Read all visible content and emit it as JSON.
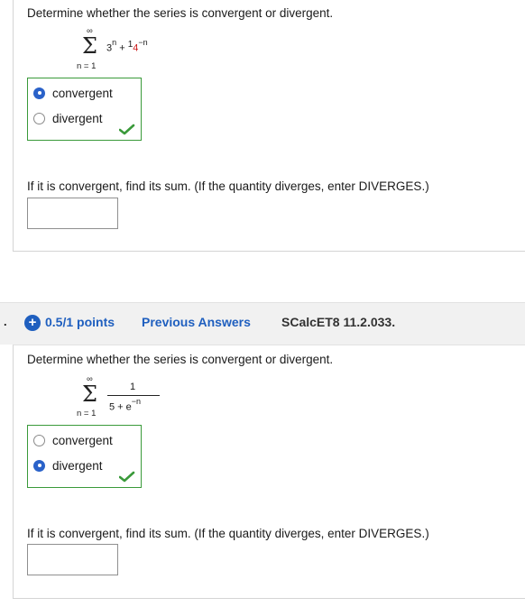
{
  "question1": {
    "prompt": "Determine whether the series is convergent or divergent.",
    "series": {
      "upper": "∞",
      "lower": "n = 1",
      "term_a": "3",
      "term_a_exp": "n",
      "plus": "+",
      "term_b": "1",
      "term_b_red": "4",
      "term_b_exp": "−n"
    },
    "choices": [
      {
        "label": "convergent",
        "selected": true
      },
      {
        "label": "divergent",
        "selected": false
      }
    ],
    "sum_prompt": "If it is convergent, find its sum. (If the quantity diverges, enter DIVERGES.)",
    "sum_value": ""
  },
  "question2": {
    "number": ".",
    "points": "0.5/1 points",
    "previous_answers": "Previous Answers",
    "code": "SCalcET8 11.2.033.",
    "prompt": "Determine whether the series is convergent or divergent.",
    "series": {
      "upper": "∞",
      "lower": "n = 1",
      "numerator": "1",
      "denominator": "5 + e",
      "denominator_exp": "−n"
    },
    "choices": [
      {
        "label": "convergent",
        "selected": false
      },
      {
        "label": "divergent",
        "selected": true
      }
    ],
    "sum_prompt": "If it is convergent, find its sum. (If the quantity diverges, enter DIVERGES.)",
    "sum_value": ""
  },
  "colors": {
    "accent": "#1f5fbf",
    "correct": "#3a9a3a",
    "radio_selected": "#2a62c9"
  }
}
